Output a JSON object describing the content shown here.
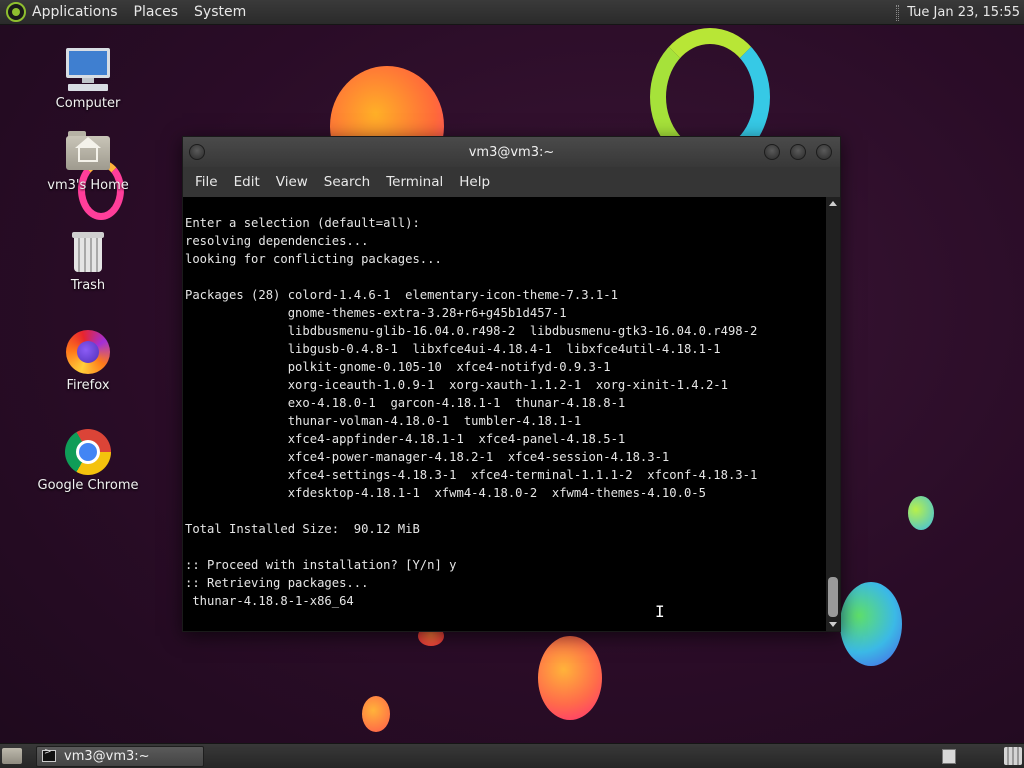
{
  "top_panel": {
    "menus": [
      "Applications",
      "Places",
      "System"
    ],
    "clock": "Tue Jan 23, 15:55"
  },
  "desktop": {
    "icons": [
      {
        "label": "Computer",
        "icon": "computer-icon"
      },
      {
        "label": "vm3's Home",
        "icon": "home-folder-icon"
      },
      {
        "label": "Trash",
        "icon": "trash-icon"
      },
      {
        "label": "Firefox",
        "icon": "firefox-icon"
      },
      {
        "label": "Google Chrome",
        "icon": "chrome-icon"
      }
    ]
  },
  "window": {
    "title": "vm3@vm3:~",
    "menu": [
      "File",
      "Edit",
      "View",
      "Search",
      "Terminal",
      "Help"
    ],
    "terminal_output": "Enter a selection (default=all):\nresolving dependencies...\nlooking for conflicting packages...\n\nPackages (28) colord-1.4.6-1  elementary-icon-theme-7.3.1-1\n              gnome-themes-extra-3.28+r6+g45b1d457-1\n              libdbusmenu-glib-16.04.0.r498-2  libdbusmenu-gtk3-16.04.0.r498-2\n              libgusb-0.4.8-1  libxfce4ui-4.18.4-1  libxfce4util-4.18.1-1\n              polkit-gnome-0.105-10  xfce4-notifyd-0.9.3-1\n              xorg-iceauth-1.0.9-1  xorg-xauth-1.1.2-1  xorg-xinit-1.4.2-1\n              exo-4.18.0-1  garcon-4.18.1-1  thunar-4.18.8-1\n              thunar-volman-4.18.0-1  tumbler-4.18.1-1\n              xfce4-appfinder-4.18.1-1  xfce4-panel-4.18.5-1\n              xfce4-power-manager-4.18.2-1  xfce4-session-4.18.3-1\n              xfce4-settings-4.18.3-1  xfce4-terminal-1.1.1-2  xfconf-4.18.3-1\n              xfdesktop-4.18.1-1  xfwm4-4.18.0-2  xfwm4-themes-4.10.0-5\n\nTotal Installed Size:  90.12 MiB\n\n:: Proceed with installation? [Y/n] y\n:: Retrieving packages...\n thunar-4.18.8-1-x86_64"
  },
  "bottom_panel": {
    "tasks": [
      {
        "label": "vm3@vm3:~",
        "icon": "terminal-icon"
      }
    ]
  },
  "colors": {
    "background": "#2a0c27",
    "panel": "#2f2f2f",
    "terminal_bg": "#000000",
    "terminal_fg": "#e6e6e6"
  }
}
